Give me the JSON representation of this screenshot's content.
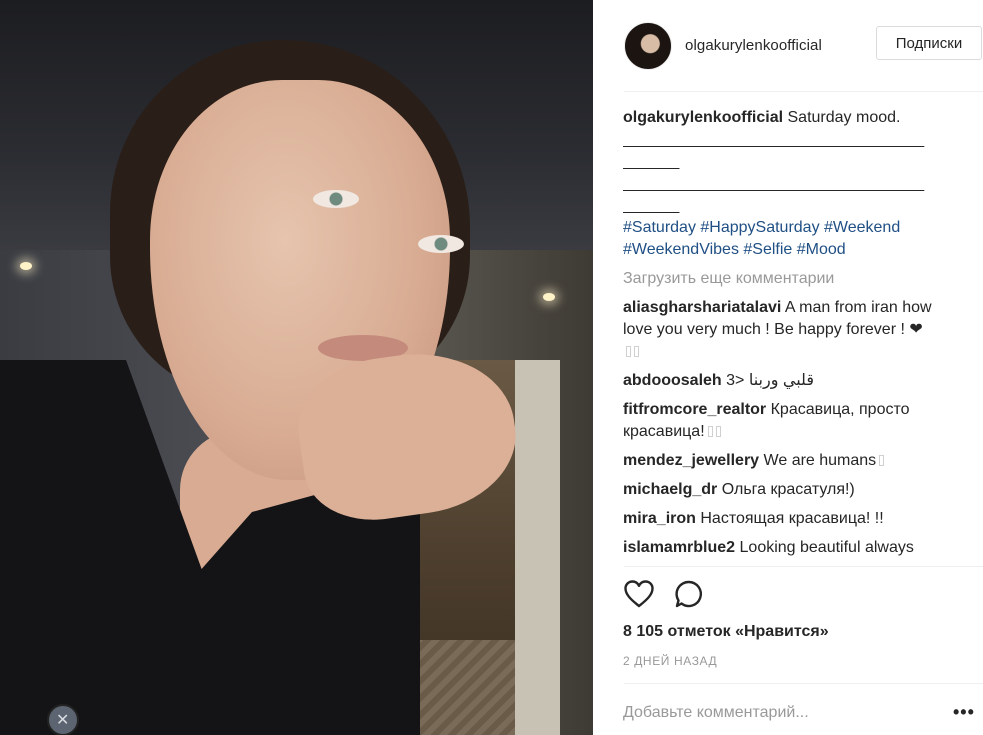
{
  "post": {
    "username": "olgakurylenkoofficial",
    "follow_label": "Подписки",
    "caption": {
      "username": "olgakurylenkoofficial",
      "text": "Saturday mood.",
      "rule_a1": "______________________________________",
      "rule_a2": "_______",
      "rule_b1": "______________________________________",
      "rule_b2": "_______",
      "hashtags_line1": "#Saturday #HappySaturday #Weekend",
      "hashtags_line2": "#WeekendVibes #Selfie #Mood"
    },
    "load_more": "Загрузить еще комментарии",
    "comments": [
      {
        "user": "aliasgharshariatalavi",
        "text": "A man from iran how love you very much ! Be happy forever ! ❤"
      },
      {
        "user": "abdooosaleh",
        "text": "قلبي وربنا <3"
      },
      {
        "user": "fitfromcore_realtor",
        "text": "Красавица, просто красавица!"
      },
      {
        "user": "mendez_jewellery",
        "text": "We are humans"
      },
      {
        "user": "michaelg_dr",
        "text": "Ольга красатуля!)"
      },
      {
        "user": "mira_iron",
        "text": "Настоящая красавица! !!"
      },
      {
        "user": "islamamrblue2",
        "text": "Looking beautiful always"
      }
    ],
    "likes": "8 105 отметок «Нравится»",
    "time": "2 ДНЕЙ НАЗАД",
    "comment_placeholder": "Добавьте комментарий...",
    "more_label": "•••"
  },
  "icons": {
    "like": "heart-icon",
    "comment": "comment-icon",
    "more": "more-options-icon"
  },
  "colors": {
    "hashtag": "#1f4f84",
    "secondary_text": "#999999",
    "divider": "#efefef"
  }
}
